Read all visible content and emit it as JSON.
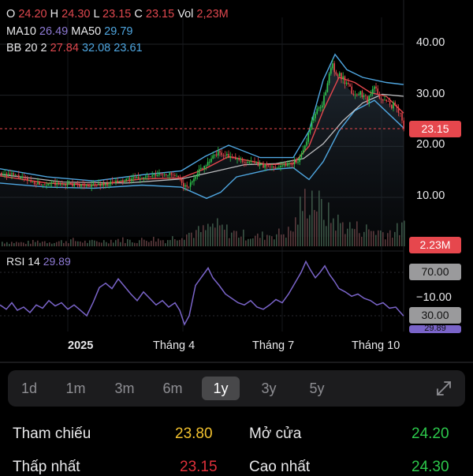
{
  "ohlc": {
    "o_label": "O",
    "o_value": "24.20",
    "h_label": "H",
    "h_value": "24.30",
    "l_label": "L",
    "l_value": "23.15",
    "c_label": "C",
    "c_value": "23.15",
    "vol_label": "Vol",
    "vol_value": "2,23M"
  },
  "ma": {
    "ma10_label": "MA10",
    "ma10_value": "26.49",
    "ma50_label": "MA50",
    "ma50_value": "29.79"
  },
  "bb": {
    "label": "BB 20 2",
    "upper": "27.84",
    "middle": "32.08",
    "lower": "23.61"
  },
  "rsi": {
    "label": "RSI 14",
    "value": "29.89",
    "level_70": "70.00",
    "level_30": "30.00",
    "level_minus10": "−10.00",
    "current_tag": "29.89"
  },
  "tags": {
    "price": "23.15",
    "volume": "2.23M"
  },
  "timeframes": [
    "1d",
    "1m",
    "3m",
    "6m",
    "1y",
    "3y",
    "5y"
  ],
  "active_timeframe": "1y",
  "stats": {
    "ref_label": "Tham chiếu",
    "ref_value": "23.80",
    "open_label": "Mở cửa",
    "open_value": "24.20",
    "low_label": "Thấp nhất",
    "low_value": "23.15",
    "high_label": "Cao nhất",
    "high_value": "24.30"
  },
  "colors": {
    "up": "#2cc84b",
    "down": "#e6474d",
    "ma_red": "#e6474d",
    "bb_blue": "#4fa6e0",
    "rsi": "#7a64c9"
  },
  "icons": {
    "expand": "expand-arrows-icon"
  },
  "chart_data": {
    "type": "candlestick",
    "price_axis": {
      "ticks": [
        10,
        20,
        30,
        40
      ],
      "tick_labels": [
        "10.00",
        "20.00",
        "30.00",
        "40.00"
      ],
      "range": [
        6,
        44
      ]
    },
    "x_labels": [
      "2025",
      "Tháng 4",
      "Tháng 7",
      "Tháng 10"
    ],
    "current_price": 23.15,
    "price_path": [
      [
        0,
        14.8
      ],
      [
        20,
        14.2
      ],
      [
        40,
        13.0
      ],
      [
        55,
        12.5
      ],
      [
        60,
        12.8
      ],
      [
        75,
        12.5
      ],
      [
        85,
        12.6
      ],
      [
        100,
        12.4
      ],
      [
        115,
        12.3
      ],
      [
        125,
        12.5
      ],
      [
        135,
        12.6
      ],
      [
        145,
        13.0
      ],
      [
        155,
        13.2
      ],
      [
        165,
        13.6
      ],
      [
        175,
        13.8
      ],
      [
        185,
        14.0
      ],
      [
        195,
        14.2
      ],
      [
        205,
        14.6
      ],
      [
        215,
        14.5
      ],
      [
        225,
        13.8
      ],
      [
        233,
        12.2
      ],
      [
        238,
        12.0
      ],
      [
        244,
        13.5
      ],
      [
        250,
        15.0
      ],
      [
        258,
        16.2
      ],
      [
        265,
        17.2
      ],
      [
        272,
        18.5
      ],
      [
        278,
        18.8
      ],
      [
        285,
        18.2
      ],
      [
        292,
        17.8
      ],
      [
        300,
        17.5
      ],
      [
        310,
        17.0
      ],
      [
        320,
        16.8
      ],
      [
        330,
        16.3
      ],
      [
        340,
        15.9
      ],
      [
        350,
        16.0
      ],
      [
        360,
        16.4
      ],
      [
        370,
        16.8
      ],
      [
        380,
        17.5
      ],
      [
        386,
        20.0
      ],
      [
        390,
        22.5
      ],
      [
        396,
        25.5
      ],
      [
        402,
        27.0
      ],
      [
        408,
        28.5
      ],
      [
        412,
        30.5
      ],
      [
        416,
        33.0
      ],
      [
        420,
        36.5
      ],
      [
        424,
        35.0
      ],
      [
        428,
        34.0
      ],
      [
        432,
        33.5
      ],
      [
        438,
        32.0
      ],
      [
        444,
        31.0
      ],
      [
        450,
        30.0
      ],
      [
        458,
        30.5
      ],
      [
        466,
        29.0
      ],
      [
        474,
        31.5
      ],
      [
        482,
        29.5
      ],
      [
        490,
        28.5
      ],
      [
        498,
        28.0
      ],
      [
        506,
        27.0
      ],
      [
        512,
        23.15
      ]
    ],
    "ma_fast": [
      [
        0,
        14.2
      ],
      [
        60,
        12.8
      ],
      [
        120,
        12.4
      ],
      [
        180,
        13.6
      ],
      [
        230,
        13.8
      ],
      [
        260,
        15.6
      ],
      [
        290,
        18.0
      ],
      [
        340,
        16.4
      ],
      [
        372,
        16.6
      ],
      [
        392,
        20.0
      ],
      [
        410,
        27.0
      ],
      [
        430,
        33.5
      ],
      [
        450,
        32.5
      ],
      [
        470,
        30.5
      ],
      [
        490,
        29.8
      ],
      [
        512,
        26.5
      ]
    ],
    "ma_slow": [
      [
        0,
        14.5
      ],
      [
        80,
        13.0
      ],
      [
        160,
        12.8
      ],
      [
        230,
        13.6
      ],
      [
        270,
        15.0
      ],
      [
        310,
        16.4
      ],
      [
        350,
        16.6
      ],
      [
        385,
        17.6
      ],
      [
        410,
        20.5
      ],
      [
        435,
        25.0
      ],
      [
        460,
        28.5
      ],
      [
        485,
        30.2
      ],
      [
        512,
        29.8
      ]
    ],
    "bb_upper": [
      [
        0,
        15.6
      ],
      [
        60,
        14.0
      ],
      [
        120,
        13.2
      ],
      [
        180,
        14.4
      ],
      [
        230,
        15.2
      ],
      [
        260,
        18.0
      ],
      [
        290,
        20.2
      ],
      [
        330,
        17.8
      ],
      [
        372,
        17.8
      ],
      [
        392,
        23.0
      ],
      [
        410,
        33.0
      ],
      [
        425,
        38.0
      ],
      [
        440,
        35.0
      ],
      [
        460,
        33.5
      ],
      [
        490,
        32.5
      ],
      [
        512,
        32.1
      ]
    ],
    "bb_lower": [
      [
        0,
        12.8
      ],
      [
        60,
        12.0
      ],
      [
        120,
        11.8
      ],
      [
        180,
        12.4
      ],
      [
        230,
        12.0
      ],
      [
        262,
        9.8
      ],
      [
        280,
        11.0
      ],
      [
        300,
        14.0
      ],
      [
        340,
        15.4
      ],
      [
        372,
        15.8
      ],
      [
        392,
        13.5
      ],
      [
        410,
        17.0
      ],
      [
        430,
        23.0
      ],
      [
        450,
        27.0
      ],
      [
        475,
        29.0
      ],
      [
        512,
        23.6
      ]
    ],
    "volume_bars": [
      [
        10,
        0.5
      ],
      [
        30,
        0.4
      ],
      [
        50,
        0.6
      ],
      [
        70,
        0.5
      ],
      [
        90,
        0.7
      ],
      [
        110,
        0.5
      ],
      [
        130,
        0.6
      ],
      [
        150,
        0.8
      ],
      [
        170,
        0.6
      ],
      [
        190,
        0.9
      ],
      [
        210,
        0.7
      ],
      [
        230,
        1.4
      ],
      [
        245,
        1.6
      ],
      [
        258,
        1.8
      ],
      [
        270,
        2.4
      ],
      [
        282,
        2.0
      ],
      [
        295,
        1.6
      ],
      [
        310,
        1.3
      ],
      [
        325,
        1.1
      ],
      [
        340,
        1.4
      ],
      [
        355,
        1.5
      ],
      [
        370,
        1.8
      ],
      [
        380,
        4.2
      ],
      [
        388,
        5.5
      ],
      [
        395,
        6.0
      ],
      [
        402,
        4.8
      ],
      [
        410,
        4.0
      ],
      [
        420,
        3.2
      ],
      [
        432,
        2.6
      ],
      [
        445,
        2.2
      ],
      [
        460,
        2.0
      ],
      [
        475,
        1.8
      ],
      [
        490,
        1.6
      ],
      [
        505,
        1.9
      ],
      [
        512,
        2.23
      ]
    ],
    "rsi_series": {
      "axis_ticks": [
        70,
        30,
        -10
      ],
      "values": [
        [
          0,
          40
        ],
        [
          8,
          36
        ],
        [
          15,
          42
        ],
        [
          22,
          35
        ],
        [
          30,
          38
        ],
        [
          38,
          33
        ],
        [
          46,
          40
        ],
        [
          54,
          37
        ],
        [
          62,
          44
        ],
        [
          70,
          39
        ],
        [
          78,
          42
        ],
        [
          86,
          36
        ],
        [
          94,
          40
        ],
        [
          102,
          35
        ],
        [
          110,
          30
        ],
        [
          118,
          42
        ],
        [
          126,
          56
        ],
        [
          134,
          60
        ],
        [
          142,
          55
        ],
        [
          150,
          64
        ],
        [
          158,
          57
        ],
        [
          166,
          50
        ],
        [
          174,
          44
        ],
        [
          182,
          52
        ],
        [
          190,
          46
        ],
        [
          198,
          40
        ],
        [
          206,
          44
        ],
        [
          214,
          38
        ],
        [
          222,
          42
        ],
        [
          228,
          35
        ],
        [
          234,
          22
        ],
        [
          240,
          30
        ],
        [
          248,
          58
        ],
        [
          256,
          66
        ],
        [
          264,
          74
        ],
        [
          270,
          65
        ],
        [
          278,
          58
        ],
        [
          286,
          50
        ],
        [
          294,
          46
        ],
        [
          302,
          42
        ],
        [
          310,
          40
        ],
        [
          318,
          44
        ],
        [
          326,
          38
        ],
        [
          334,
          36
        ],
        [
          342,
          40
        ],
        [
          350,
          45
        ],
        [
          358,
          42
        ],
        [
          366,
          50
        ],
        [
          374,
          60
        ],
        [
          382,
          70
        ],
        [
          388,
          80
        ],
        [
          394,
          72
        ],
        [
          400,
          65
        ],
        [
          406,
          70
        ],
        [
          412,
          76
        ],
        [
          418,
          68
        ],
        [
          424,
          62
        ],
        [
          430,
          55
        ],
        [
          438,
          52
        ],
        [
          446,
          48
        ],
        [
          454,
          50
        ],
        [
          462,
          46
        ],
        [
          470,
          44
        ],
        [
          478,
          40
        ],
        [
          486,
          42
        ],
        [
          494,
          37
        ],
        [
          502,
          38
        ],
        [
          508,
          33
        ],
        [
          512,
          29.89
        ]
      ]
    }
  }
}
